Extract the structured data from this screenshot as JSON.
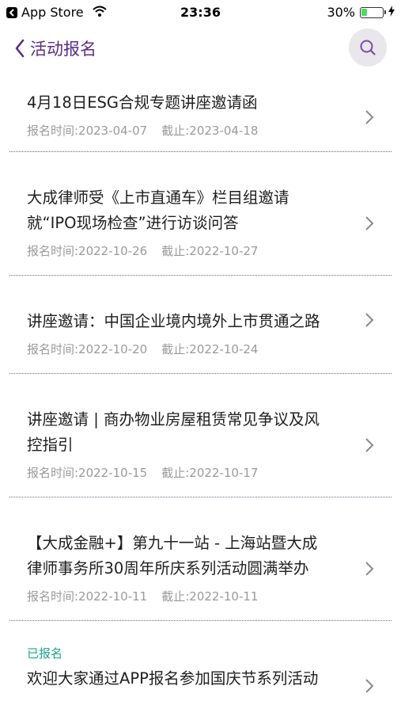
{
  "status_bar": {
    "back_app": "App Store",
    "time": "23:36",
    "battery": "30%",
    "battery_level": 0.3
  },
  "nav": {
    "title": "活动报名"
  },
  "events": [
    {
      "title_lines": [
        "4月18日ESG合规专题讲座邀请函"
      ],
      "signup": "报名时间:2023-04-07",
      "deadline": "截止:2023-04-18"
    },
    {
      "title_lines": [
        "大成律师受《上市直通车》栏目组邀请",
        "就“IPO现场检查”进行访谈问答"
      ],
      "signup": "报名时间:2022-10-26",
      "deadline": "截止:2022-10-27"
    },
    {
      "title_lines": [
        "讲座邀请：中国企业境内境外上市贯通之路"
      ],
      "signup": "报名时间:2022-10-20",
      "deadline": "截止:2022-10-24"
    },
    {
      "title_lines": [
        "讲座邀请 | 商办物业房屋租赁常见争议及风",
        "控指引"
      ],
      "signup": "报名时间:2022-10-15",
      "deadline": "截止:2022-10-17"
    },
    {
      "title_lines": [
        "【大成金融+】第九十一站 - 上海站暨大成",
        "律师事务所30周年所庆系列活动圆满举办"
      ],
      "signup": "报名时间:2022-10-11",
      "deadline": "截止:2022-10-11"
    },
    {
      "status": "已报名",
      "title_lines": [
        "欢迎大家通过APP报名参加国庆节系列活动"
      ]
    }
  ],
  "colors": {
    "accent": "#5b2d86",
    "registered": "#1aa68a",
    "meta": "#9a9a9a"
  }
}
